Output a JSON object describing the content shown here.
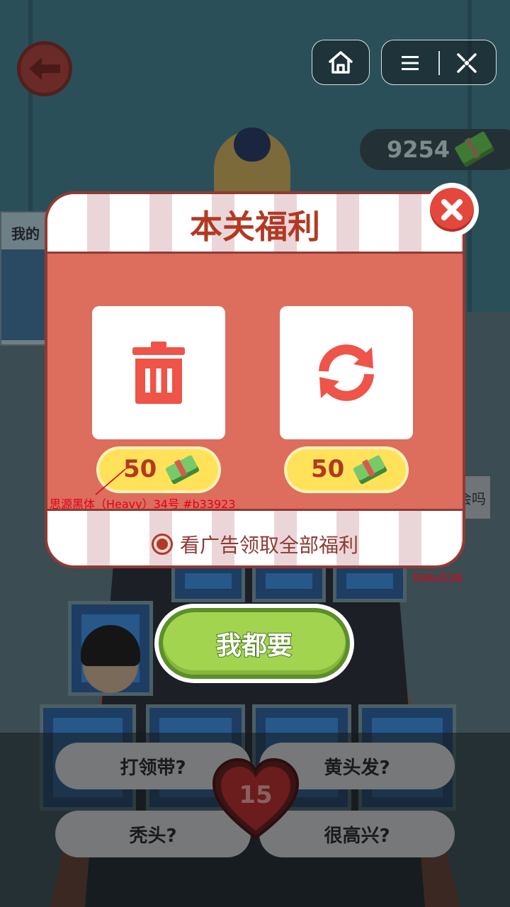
{
  "hud": {
    "coins": "9254",
    "coin_icon": "cash-stack-icon"
  },
  "system": {
    "home_icon": "home-icon",
    "menu_icon": "menu-icon",
    "close_icon": "close-miniprogram-icon"
  },
  "background": {
    "side_card_label": "我的",
    "side_bubble_text": "会吗",
    "question_buttons": [
      "打领带?",
      "黄头发?",
      "秃头?",
      "很高兴?"
    ],
    "lives": "15"
  },
  "dialog": {
    "title": "本关福利",
    "items": [
      {
        "icon": "trash-icon",
        "price": "50"
      },
      {
        "icon": "refresh-icon",
        "price": "50"
      }
    ],
    "ad_option": "看广告领取全部福利",
    "annotation": "思源黑体（Heavy）34号 #b33923",
    "size_note": "594x538"
  },
  "cta": {
    "label": "我都要"
  },
  "colors": {
    "accent_red": "#b33923",
    "panel_bg": "#dd6d5c",
    "gold": "#ffe25a",
    "green": "#a3d44f"
  }
}
